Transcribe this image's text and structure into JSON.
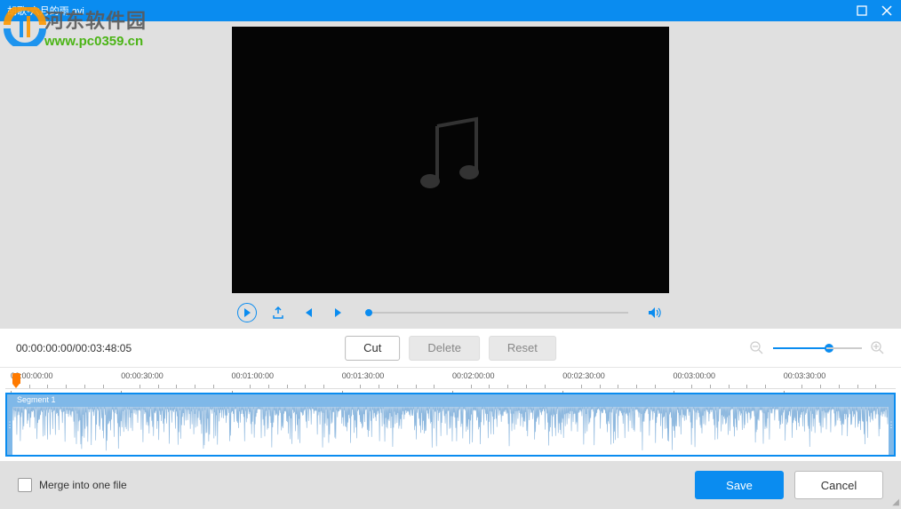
{
  "titlebar": {
    "title": "胡歌-六月的雨.avi"
  },
  "watermark": {
    "line1": "河东软件园",
    "line2": "www.pc0359.cn"
  },
  "toolbar": {
    "timecode": "00:00:00:00/00:03:48:05",
    "cut": "Cut",
    "delete": "Delete",
    "reset": "Reset"
  },
  "ruler": {
    "ticks": [
      "00:00:00:00",
      "00:00:30:00",
      "00:01:00:00",
      "00:01:30:00",
      "00:02:00:00",
      "00:02:30:00",
      "00:03:00:00",
      "00:03:30:00"
    ]
  },
  "segment": {
    "label": "Segment 1"
  },
  "footer": {
    "merge": "Merge into one file",
    "save": "Save",
    "cancel": "Cancel"
  }
}
